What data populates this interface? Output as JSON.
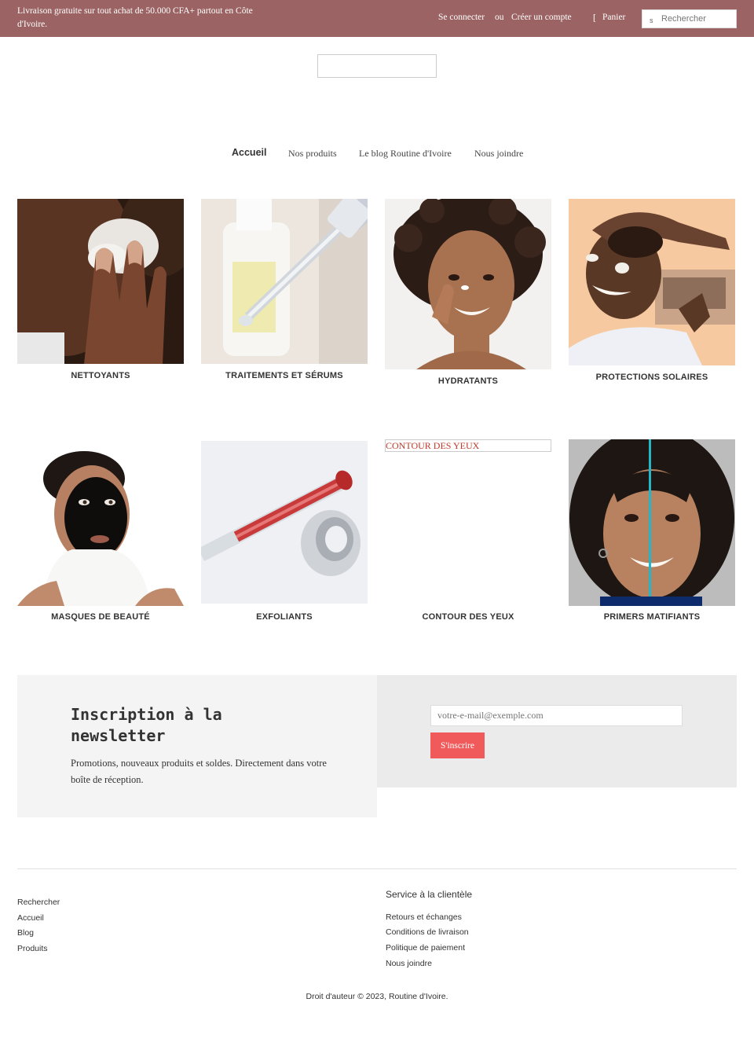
{
  "topbar": {
    "promo": "Livraison gratuite sur tout achat de 50.000 CFA+ partout en Côte d'Ivoire.",
    "login": "Se connecter",
    "or": "ou",
    "register": "Créer un compte",
    "cart_icon": "[",
    "cart": "Panier",
    "search_icon": "s",
    "search_placeholder": "Rechercher",
    "background": "#9b6363"
  },
  "nav": {
    "items": [
      "Accueil",
      "Nos produits",
      "Le blog Routine d'Ivoire",
      "Nous joindre"
    ]
  },
  "collections": [
    {
      "label": "NETTOYANTS",
      "image": "face-wash-photo"
    },
    {
      "label": "TRAITEMENTS ET SÉRUMS",
      "image": "serum-dropper-photo"
    },
    {
      "label": "HYDRATANTS",
      "image": "moisturizer-woman-photo"
    },
    {
      "label": "PROTECTIONS SOLAIRES",
      "image": "sunscreen-woman-photo"
    },
    {
      "label": "MASQUES DE BEAUTÉ",
      "image": "face-mask-photo"
    },
    {
      "label": "EXFOLIANTS",
      "image": "exfoliant-dropper-photo"
    },
    {
      "label": "CONTOUR DES YEUX",
      "broken_alt": "CONTOUR DES YEUX"
    },
    {
      "label": "PRIMERS MATIFIANTS",
      "image": "primer-woman-photo"
    }
  ],
  "newsletter": {
    "title": "Inscription à la newsletter",
    "description": "Promotions, nouveaux produits et soldes. Directement dans votre boîte de réception.",
    "placeholder": "votre-e-mail@exemple.com",
    "button": "S'inscrire",
    "button_color": "#f05a5a"
  },
  "footer": {
    "links": [
      "Rechercher",
      "Accueil",
      "Blog",
      "Produits"
    ],
    "service_title": "Service à la clientèle",
    "service_links": [
      "Retours et échanges",
      "Conditions de livraison",
      "Politique de paiement",
      "Nous joindre"
    ],
    "copyright": "Droit d'auteur © 2023, Routine d'Ivoire."
  }
}
